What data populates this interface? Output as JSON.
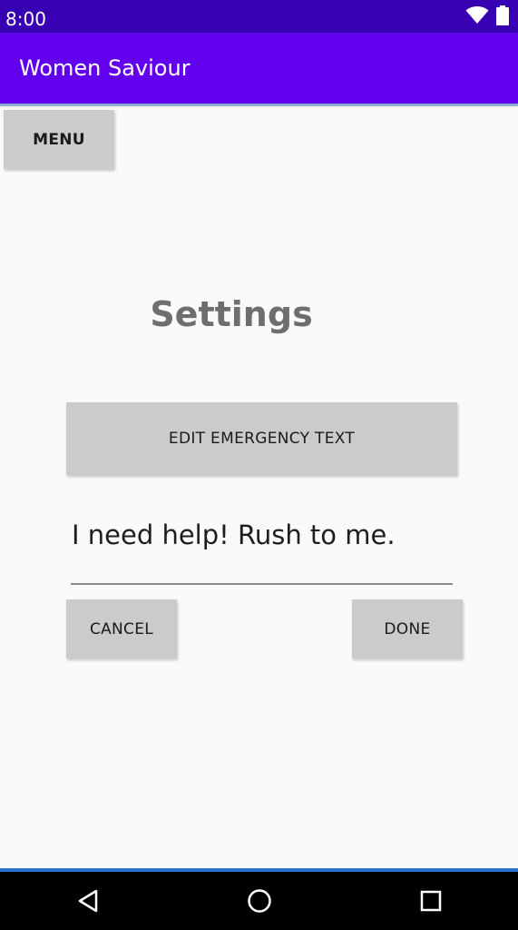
{
  "status_bar": {
    "time": "8:00",
    "icons": [
      "wifi-icon",
      "battery-icon"
    ]
  },
  "app_bar": {
    "title": "Women Saviour",
    "color": "#6200ee",
    "status_color": "#3700b3"
  },
  "menu_button": {
    "label": "MENU"
  },
  "heading": "Settings",
  "edit_button": {
    "label": "EDIT EMERGENCY TEXT"
  },
  "emergency_text_field": {
    "value": "I need help! Rush to me."
  },
  "cancel_button": {
    "label": "CANCEL"
  },
  "done_button": {
    "label": "DONE"
  },
  "nav_bar": {
    "buttons": [
      "back-icon",
      "home-icon",
      "recents-icon"
    ]
  }
}
